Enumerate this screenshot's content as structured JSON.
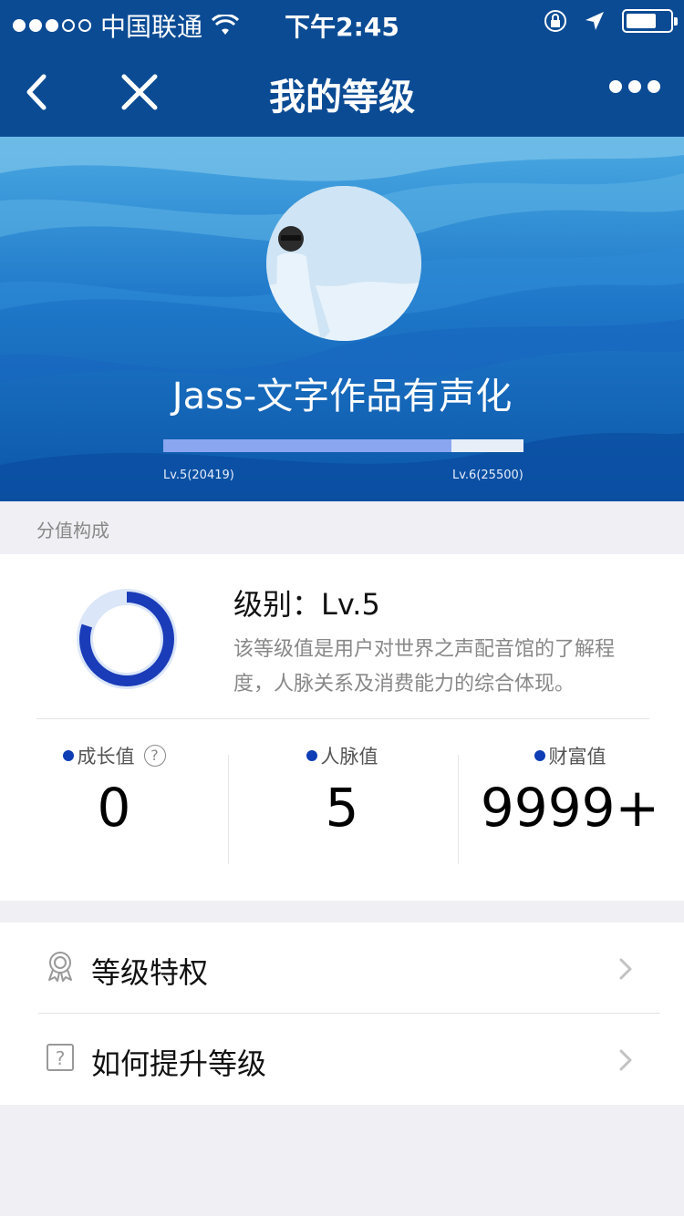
{
  "status_bar": {
    "carrier": "中国联通",
    "time": "下午2:45",
    "battery_level": 0.7
  },
  "nav": {
    "title": "我的等级"
  },
  "profile": {
    "username": "Jass-文字作品有声化",
    "progress": {
      "current_label": "Lv.5(20419)",
      "next_label": "Lv.6(25500)",
      "fraction": 0.8
    }
  },
  "section": {
    "title": "分值构成"
  },
  "level_card": {
    "level_title": "级别：Lv.5",
    "description": "该等级值是用户对世界之声配音馆的了解程度，人脉关系及消费能力的综合体现。",
    "ring_fraction": 0.8,
    "stats": [
      {
        "label": "成长值",
        "value": "0",
        "help": "?"
      },
      {
        "label": "人脉值",
        "value": "5"
      },
      {
        "label": "财富值",
        "value": "9999+"
      }
    ]
  },
  "menu": {
    "items": [
      {
        "label": "等级特权",
        "icon": "medal-icon"
      },
      {
        "label": "如何提升等级",
        "icon": "question-box-icon"
      }
    ]
  },
  "colors": {
    "nav_bg": "#0b4b94",
    "accent": "#0f3db5",
    "progress_fill": "#8aa6f0"
  }
}
